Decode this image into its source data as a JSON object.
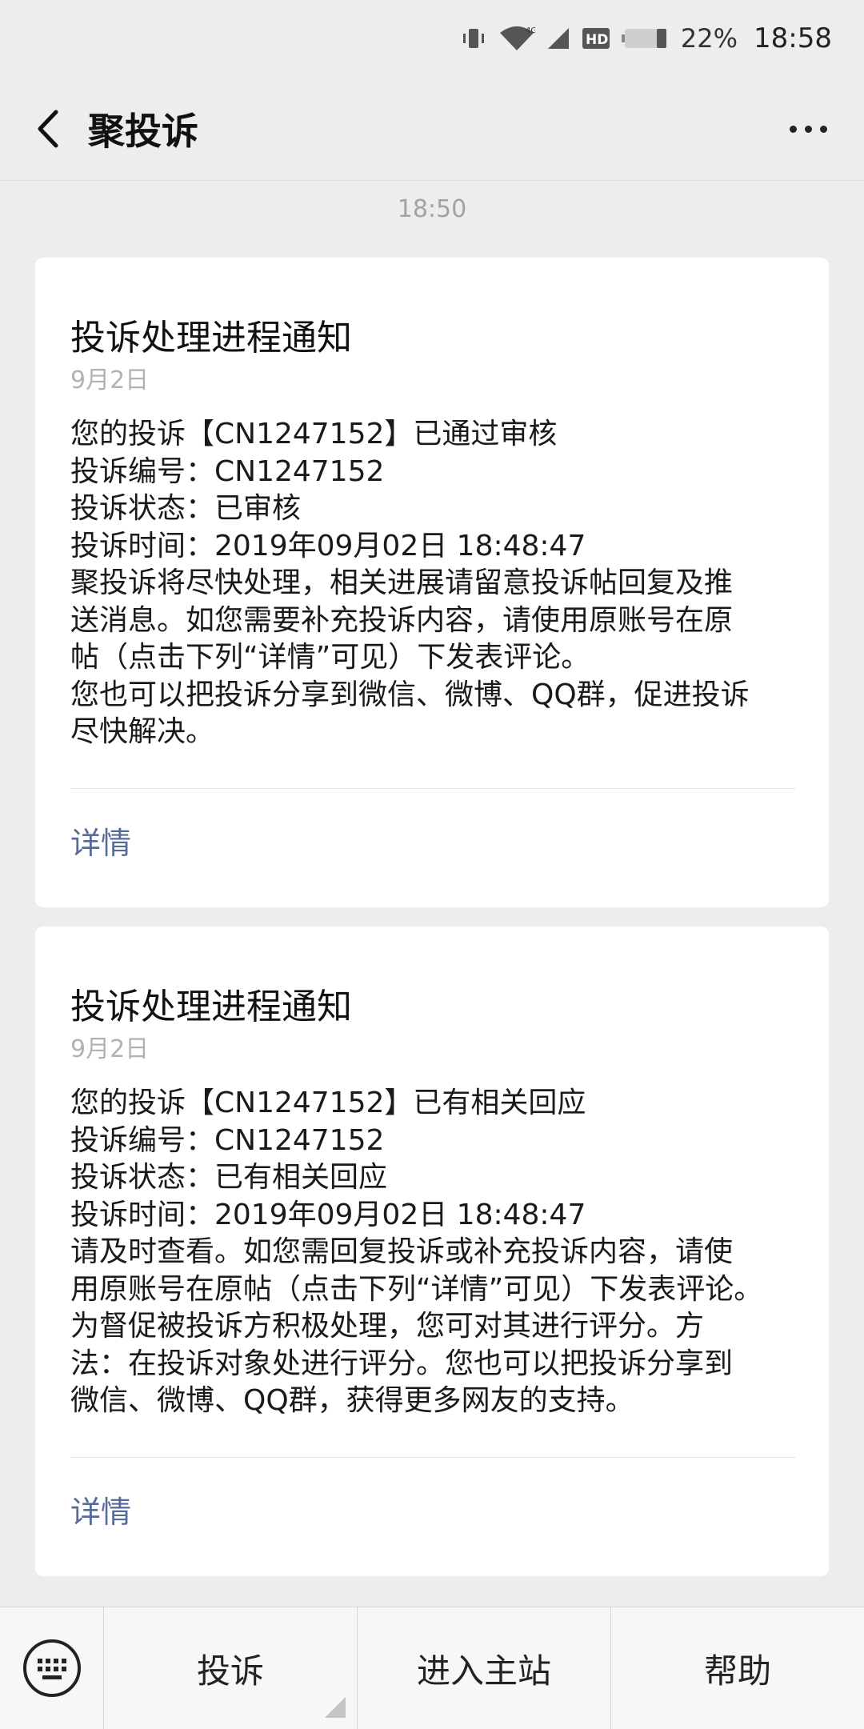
{
  "status_bar": {
    "battery_percent": "22%",
    "time": "18:58",
    "network_label": "4G",
    "hd_label": "HD"
  },
  "nav": {
    "title": "聚投诉"
  },
  "chat": {
    "timestamp": "18:50",
    "messages": [
      {
        "title": "投诉处理进程通知",
        "date": "9月2日",
        "lines": [
          "您的投诉【CN1247152】已通过审核",
          "投诉编号：CN1247152",
          "投诉状态：已审核",
          "投诉时间：2019年09月02日 18:48:47",
          "聚投诉将尽快处理，相关进展请留意投诉帖回复及推",
          "送消息。如您需要补充投诉内容，请使用原账号在原",
          "帖（点击下列“详情”可见）下发表评论。",
          "您也可以把投诉分享到微信、微博、QQ群，促进投诉",
          "尽快解决。"
        ],
        "link_label": "详情"
      },
      {
        "title": "投诉处理进程通知",
        "date": "9月2日",
        "lines": [
          "您的投诉【CN1247152】已有相关回应",
          "投诉编号：CN1247152",
          "投诉状态：已有相关回应",
          "投诉时间：2019年09月02日 18:48:47",
          "请及时查看。如您需回复投诉或补充投诉内容，请使",
          "用原账号在原帖（点击下列“详情”可见）下发表评论。",
          "为督促被投诉方积极处理，您可对其进行评分。方",
          "法：在投诉对象处进行评分。您也可以把投诉分享到",
          "微信、微博、QQ群，获得更多网友的支持。"
        ],
        "link_label": "详情"
      }
    ]
  },
  "bottom_menu": {
    "items": [
      {
        "label": "投诉"
      },
      {
        "label": "进入主站"
      },
      {
        "label": "帮助"
      }
    ]
  }
}
